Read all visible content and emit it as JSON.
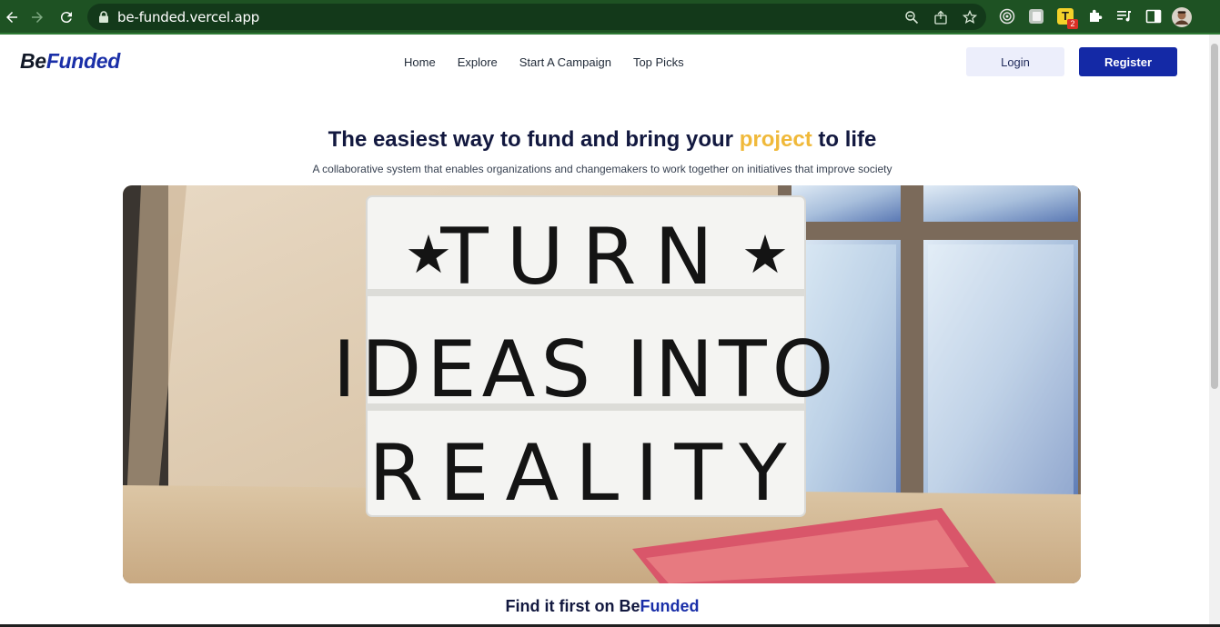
{
  "browser": {
    "url": "be-funded.vercel.app",
    "extension_badge": "2"
  },
  "header": {
    "logo_be": "Be",
    "logo_funded": "Funded",
    "nav": [
      "Home",
      "Explore",
      "Start A Campaign",
      "Top Picks"
    ],
    "login_label": "Login",
    "register_label": "Register"
  },
  "hero": {
    "title_start": "The easiest way to fund and bring your ",
    "title_accent": "project",
    "title_end": " to life",
    "subtitle": "A collaborative system that enables organizations and changemakers to work together on initiatives that improve society",
    "lightbox_line1": "TURN",
    "lightbox_line2": "IDEAS INTO",
    "lightbox_line3": "REALITY"
  },
  "section": {
    "find_prefix": "Find it first on ",
    "find_be": "Be",
    "find_funded": "Funded"
  },
  "colors": {
    "brand_blue": "#1a2fa8",
    "accent_yellow": "#f0b93a",
    "chrome_green": "#1e5223"
  }
}
